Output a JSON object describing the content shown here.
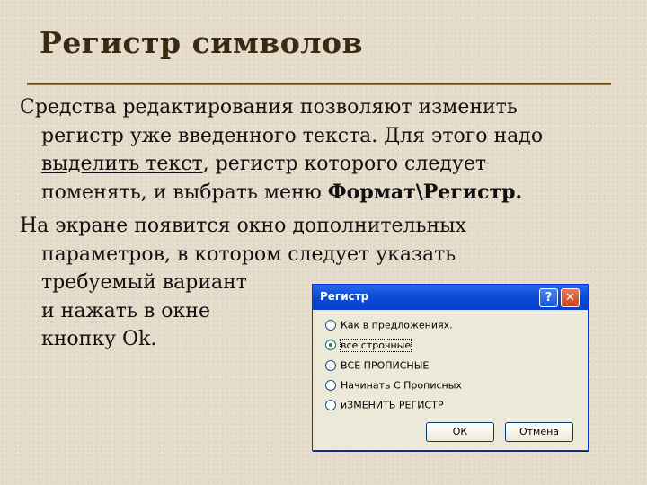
{
  "title": "Регистр символов",
  "para1": {
    "line1": "Средства редактирования позволяют изменить",
    "line2": "регистр уже введенного текста. Для этого надо",
    "line3_link": "выделить текст",
    "line3_rest": ", регистр которого следует",
    "line4_pre": "поменять,  и выбрать меню ",
    "line4_menu": "Формат\\Регистр."
  },
  "para2": {
    "line1": "На экране появится окно дополнительных",
    "line2": "параметров, в котором следует указать",
    "line3": "требуемый вариант",
    "line4": "и нажать в окне",
    "line5": "кнопку Ok."
  },
  "dialog": {
    "title": "Регистр",
    "help_glyph": "?",
    "close_glyph": "✕",
    "options": [
      {
        "label": "Как в предложениях.",
        "checked": false
      },
      {
        "label": "все строчные",
        "checked": true
      },
      {
        "label": "ВСЕ ПРОПИСНЫЕ",
        "checked": false
      },
      {
        "label": "Начинать С Прописных",
        "checked": false
      },
      {
        "label": "иЗМЕНИТЬ РЕГИСТР",
        "checked": false
      }
    ],
    "ok_label": "ОК",
    "cancel_label": "Отмена"
  }
}
